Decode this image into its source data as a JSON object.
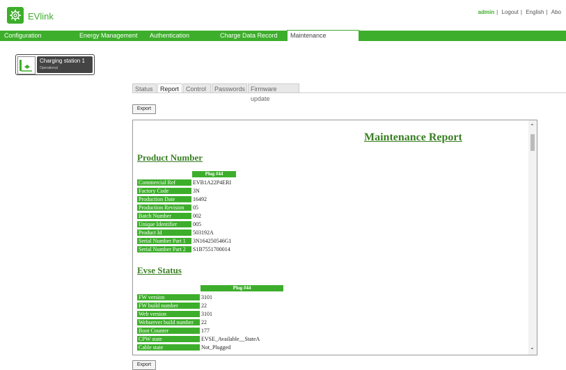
{
  "header": {
    "app_name": "EVlink",
    "user": "admin",
    "links": [
      "Logout",
      "English",
      "Abo"
    ]
  },
  "menu": {
    "items": [
      "Configuration",
      "Energy Management",
      "Authentication",
      "Charge Data Record",
      "Maintenance"
    ],
    "active": "Maintenance"
  },
  "station": {
    "name": "Charging station 1",
    "status": "Operational"
  },
  "tabs": {
    "items": [
      "Status",
      "Report",
      "Control",
      "Passwords",
      "Firmware update"
    ],
    "active": "Report"
  },
  "toolbar": {
    "export_label": "Export"
  },
  "report": {
    "title": "Maintenance Report",
    "product": {
      "title": "Product Number",
      "plug": "Plug #44",
      "rows": [
        {
          "key": "Commercial Ref",
          "value": "EVB1A22P4ERI"
        },
        {
          "key": "Factory Code",
          "value": "3N"
        },
        {
          "key": "Production Date",
          "value": "16492"
        },
        {
          "key": "Production Revision",
          "value": "05"
        },
        {
          "key": "Batch Number",
          "value": "002"
        },
        {
          "key": "Unique Identifier",
          "value": "005"
        },
        {
          "key": "Product Id",
          "value": "503192A"
        },
        {
          "key": "Serial Number Part 1",
          "value": "3N164250546G1"
        },
        {
          "key": "Serial Number Part 2",
          "value": "S1B7551700014"
        }
      ]
    },
    "evse": {
      "title": "Evse Status",
      "plug": "Plug #44",
      "rows": [
        {
          "key": "FW version",
          "value": "3101"
        },
        {
          "key": "FW build number",
          "value": "22"
        },
        {
          "key": "Web version",
          "value": "3101"
        },
        {
          "key": "Webserver build number",
          "value": "22"
        },
        {
          "key": "Boot Counter",
          "value": "177"
        },
        {
          "key": "CPW state",
          "value": "EVSE_Available__StateA"
        },
        {
          "key": "Cable state",
          "value": "Not_Plugged"
        }
      ]
    }
  },
  "colors": {
    "brand": "#3dae2b",
    "title": "#3a7f24"
  },
  "icons": {
    "logo": "gear-icon",
    "station": "charging-station-icon"
  }
}
